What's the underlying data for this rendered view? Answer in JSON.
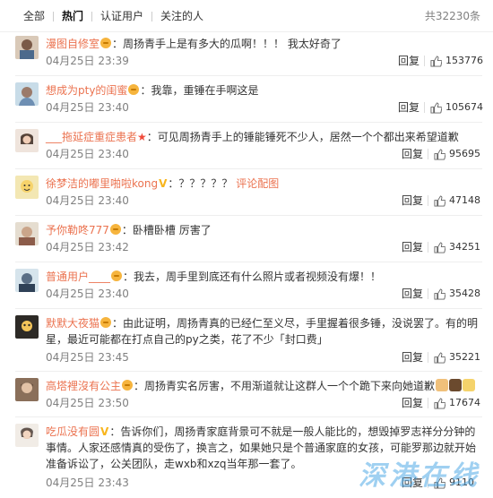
{
  "tabs": [
    "全部",
    "热门",
    "认证用户",
    "关注的人"
  ],
  "total": "共32230条",
  "reply_label": "回复",
  "comments": [
    {
      "user": "漫图自修室",
      "text": "周扬青手上是有多大的瓜啊！！！ 我太好奇了",
      "time": "04月25日 23:39",
      "likes": "153776"
    },
    {
      "user": "想成为pty的闺蜜",
      "text": "我靠，重锤在手啊这是",
      "time": "04月25日 23:40",
      "likes": "105674"
    },
    {
      "user": "___拖延症重症患者",
      "text": "可见周扬青手上的锤能锤死不少人，居然一个个都出来希望道歉",
      "time": "04月25日 23:40",
      "likes": "95695"
    },
    {
      "user": "徐梦洁的嘟里啪啦kong",
      "text": "？？？？？",
      "link": "评论配图",
      "time": "04月25日 23:40",
      "likes": "47148"
    },
    {
      "user": "予你勒咚777",
      "text": "卧槽卧槽 厉害了",
      "time": "04月25日 23:42",
      "likes": "34251"
    },
    {
      "user": "普通用户____",
      "text": "我去，周手里到底还有什么照片或者视频没有爆！！",
      "time": "04月25日 23:40",
      "likes": "35428"
    },
    {
      "user": "默默大夜猫",
      "text": "由此证明，周扬青真的已经仁至义尽，手里握着很多锤，没说罢了。有的明星，最近可能都在打点自己的py之类，花了不少「封口费」",
      "time": "04月25日 23:45",
      "likes": "35221"
    },
    {
      "user": "高塔裡沒有公主",
      "text": "周扬青实名厉害，不用渐道就让这群人一个个跪下来向她道歉",
      "time": "04月25日 23:50",
      "likes": "17674"
    },
    {
      "user": "吃瓜没有圆",
      "text": "告诉你们，周扬青家庭背景可不就是一般人能比的，想毁掉罗志祥分分钟的事情。人家还感情真的受伤了，换言之，如果她只是个普通家庭的女孩，可能罗那边就开始准备诉讼了，公关团队，走wxb和xzq当年那一套了。",
      "time": "04月25日 23:43",
      "likes": "9110"
    }
  ],
  "watermark": "深港在线",
  "colors": {
    "username": "#eb7350",
    "meta": "#808080",
    "vip": "#f8b51c",
    "star": "#f04b3b"
  }
}
